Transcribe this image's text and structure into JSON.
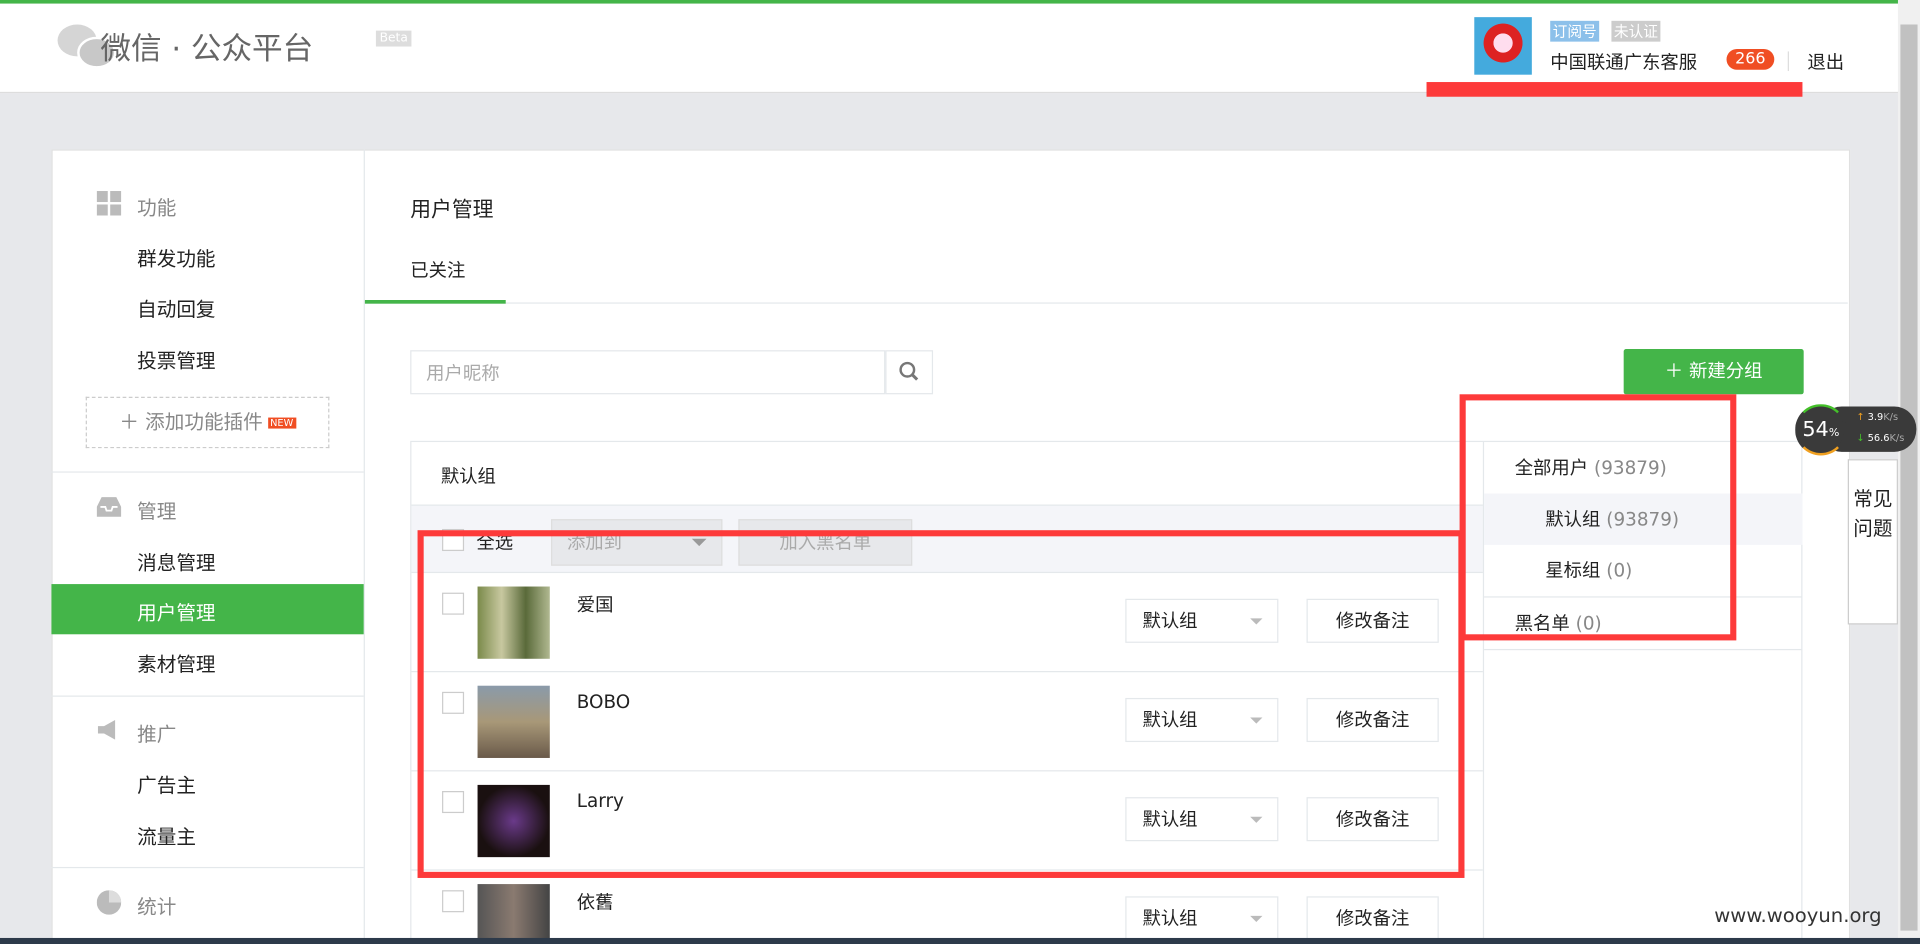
{
  "header": {
    "logo_text": "微信 · 公众平台",
    "beta": "Beta",
    "account_type": "订阅号",
    "verify_status": "未认证",
    "account_name": "中国联通广东客服",
    "notification_count": "266",
    "logout": "退出"
  },
  "sidebar": {
    "sections": [
      {
        "title": "功能",
        "icon": "grid-icon",
        "items": [
          "群发功能",
          "自动回复",
          "投票管理"
        ]
      },
      {
        "title": "管理",
        "icon": "inbox-icon",
        "items": [
          "消息管理",
          "用户管理",
          "素材管理"
        ]
      },
      {
        "title": "推广",
        "icon": "megaphone-icon",
        "items": [
          "广告主",
          "流量主"
        ]
      },
      {
        "title": "统计",
        "icon": "pie-chart-icon",
        "items": []
      }
    ],
    "add_plugin": "添加功能插件",
    "new_badge": "NEW",
    "active": "用户管理"
  },
  "main": {
    "title": "用户管理",
    "tab": "已关注",
    "search_placeholder": "用户昵称",
    "new_group": "新建分组",
    "current_group": "默认组",
    "toolbar": {
      "select_all": "全选",
      "add_to": "添加到",
      "blacklist": "加入黑名单"
    },
    "users": [
      {
        "name": "爱国",
        "group": "默认组",
        "action": "修改备注"
      },
      {
        "name": "BOBO",
        "group": "默认组",
        "action": "修改备注"
      },
      {
        "name": "Larry",
        "group": "默认组",
        "action": "修改备注"
      },
      {
        "name": "依舊",
        "group": "默认组",
        "action": "修改备注"
      }
    ],
    "groups": [
      {
        "label": "全部用户",
        "count": "(93879)"
      },
      {
        "label": "默认组",
        "count": "(93879)"
      },
      {
        "label": "星标组",
        "count": "(0)"
      },
      {
        "label": "黑名单",
        "count": "(0)"
      }
    ]
  },
  "speed_widget": {
    "percent": "54",
    "unit": "%",
    "up": "3.9",
    "down": "56.6",
    "rate_unit": "K/s"
  },
  "faq": "常见问题",
  "watermark": "www.wooyun.org",
  "colors": {
    "brand": "#44b549",
    "highlight": "#fd3a3a",
    "badge": "#f04e23"
  }
}
